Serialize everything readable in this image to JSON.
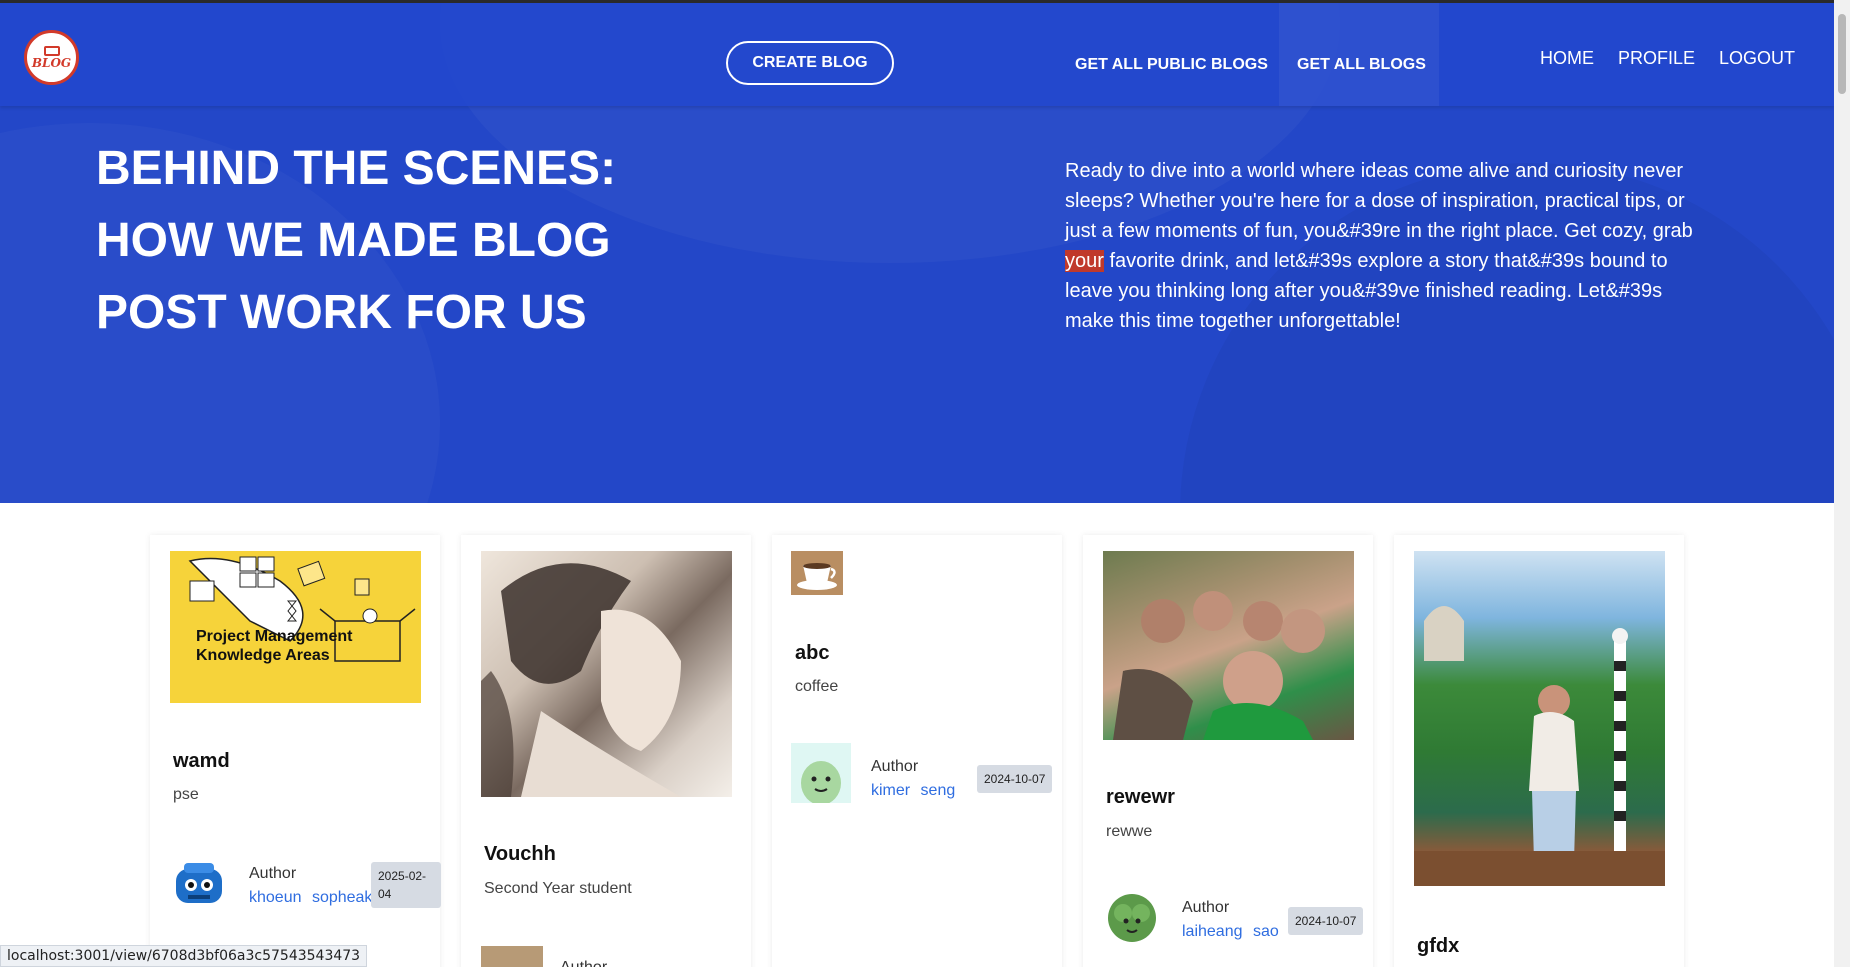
{
  "navbar": {
    "logo_text": "BLOG",
    "create_blog": "CREATE BLOG",
    "get_all_public_blogs": "GET ALL PUBLIC BLOGS",
    "get_all_blogs": "GET ALL BLOGS",
    "home": "HOME",
    "profile": "PROFILE",
    "logout": "LOGOUT"
  },
  "hero": {
    "title_line1": "BEHIND THE SCENES:",
    "title_line2": "HOW WE MADE BLOG",
    "title_line3": "POST WORK FOR US",
    "desc_part1": "Ready to dive into a world where ideas come alive and curiosity never sleeps? Whether you're here for a dose of inspiration, practical tips, or just a few moments of fun, you&#39re in the right place. Get cozy, grab ",
    "desc_highlight": "your",
    "desc_part2": " favorite drink, and let&#39s explore a story that&#39s bound to leave you thinking long after you&#39ve finished reading. Let&#39s make this time together unforgettable!"
  },
  "cards": [
    {
      "image_text": "Project Management Knowledge Areas",
      "title": "wamd",
      "subtitle": "pse",
      "author_label": "Author",
      "author_name": "khoeun sopheak",
      "date": "2025-02-04"
    },
    {
      "title": "Vouchh",
      "subtitle": "Second Year student",
      "author_label": "Author"
    },
    {
      "title": "abc",
      "subtitle": "coffee",
      "author_label": "Author",
      "author_name": "kimer seng",
      "date": "2024-10-07"
    },
    {
      "title": "rewewr",
      "subtitle": "rewwe",
      "author_label": "Author",
      "author_name": "laiheang sao",
      "date": "2024-10-07"
    },
    {
      "title": "gfdx"
    }
  ],
  "status_bar": {
    "url": "localhost:3001/view/6708d3bf06a3c57543543473"
  },
  "colors": {
    "hero_bg": "#2347c8",
    "accent_red": "#d23a2a",
    "link_blue": "#2f6de0"
  }
}
